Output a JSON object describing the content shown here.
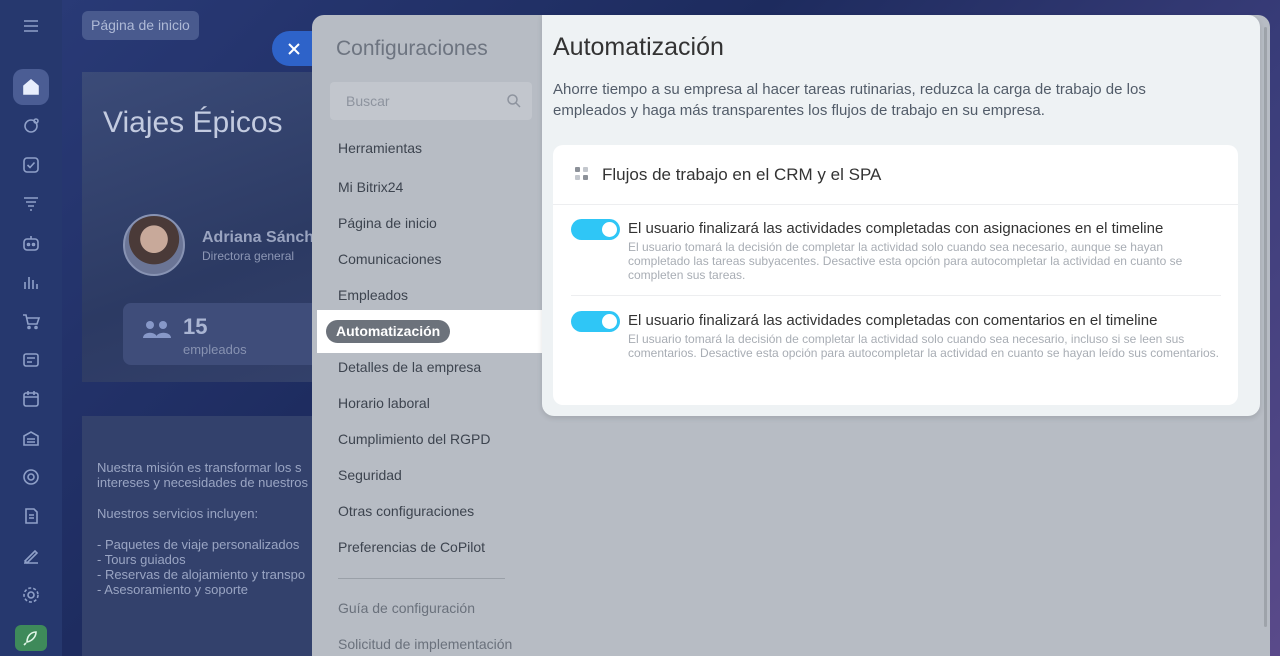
{
  "background": {
    "home_chip": "Página de inicio",
    "hero_title": "Viajes Épicos",
    "person": {
      "name": "Adriana Sánch",
      "role": "Directora general"
    },
    "stat": {
      "number": "15",
      "label": "empleados"
    },
    "mission_lines": [
      "Nuestra misión es transformar los s",
      "intereses y necesidades de nuestros",
      "Nuestros servicios incluyen:",
      "- Paquetes de viaje personalizados",
      "- Tours guiados",
      "- Reservas de alojamiento y transpo",
      "- Asesoramiento y soporte"
    ]
  },
  "settings": {
    "title": "Configuraciones",
    "search_placeholder": "Buscar",
    "menu": [
      "Herramientas",
      "Mi Bitrix24",
      "Página de inicio",
      "Comunicaciones",
      "Empleados",
      "Automatización",
      "Detalles de la empresa",
      "Horario laboral",
      "Cumplimiento del RGPD",
      "Seguridad",
      "Otras configuraciones",
      "Preferencias de CoPilot"
    ],
    "active_index": 5,
    "footer_links": [
      "Guía de configuración",
      "Solicitud de implementación"
    ]
  },
  "content": {
    "title": "Automatización",
    "description": "Ahorre tiempo a su empresa al hacer tareas rutinarias, reduzca la carga de trabajo de los empleados y haga más transparentes los flujos de trabajo en su empresa.",
    "section_title": "Flujos de trabajo en el CRM y el SPA",
    "options": [
      {
        "enabled": true,
        "label": "El usuario finalizará las actividades completadas con asignaciones en el timeline",
        "hint": "El usuario tomará la decisión de completar la actividad solo cuando sea necesario, aunque se hayan completado las tareas subyacentes. Desactive esta opción para autocompletar la actividad en cuanto se completen sus tareas."
      },
      {
        "enabled": true,
        "label": "El usuario finalizará las actividades completadas con comentarios en el timeline",
        "hint": "El usuario tomará la decisión de completar la actividad solo cuando sea necesario, incluso si se leen sus comentarios. Desactive esta opción para autocompletar la actividad en cuanto se hayan leído sus comentarios."
      }
    ]
  },
  "colors": {
    "toggle_on": "#2fc6f6",
    "close_button": "#2e63c9",
    "active_pill": "#6c727b"
  }
}
